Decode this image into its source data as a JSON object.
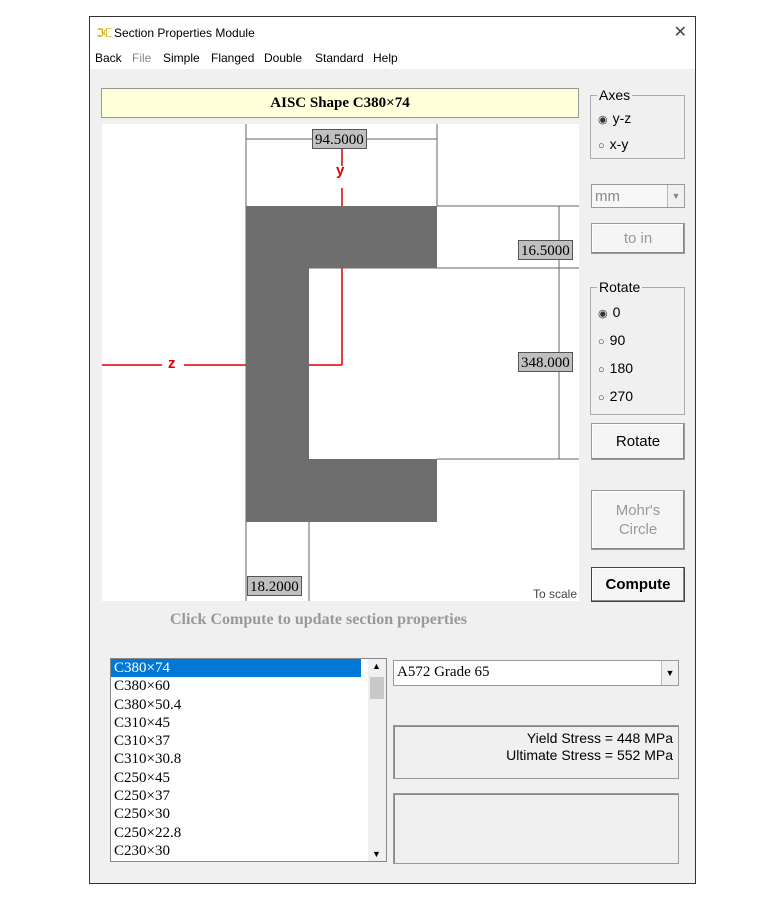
{
  "window": {
    "title": "Section Properties Module",
    "icon": "app-logo-icon"
  },
  "menu": [
    {
      "label": "Back",
      "enabled": true
    },
    {
      "label": "File",
      "enabled": false
    },
    {
      "label": "Simple",
      "enabled": true
    },
    {
      "label": "Flanged",
      "enabled": true
    },
    {
      "label": "Double",
      "enabled": true
    },
    {
      "label": "Standard",
      "enabled": true
    },
    {
      "label": "Help",
      "enabled": true
    }
  ],
  "shape_header": "AISC Shape  C380×74",
  "drawing": {
    "flange_width": "94.5000",
    "flange_thickness": "16.5000",
    "depth": "348.000",
    "web_thickness": "18.2000",
    "axis_y": "y",
    "axis_z": "z",
    "scale_note": "To scale"
  },
  "axes": {
    "label": "Axes",
    "options": [
      "y-z",
      "x-y"
    ],
    "selected": "y-z"
  },
  "units": {
    "value": "mm",
    "convert_label": "to in"
  },
  "rotate": {
    "label": "Rotate",
    "options": [
      "0",
      "90",
      "180",
      "270"
    ],
    "selected": "0",
    "button_label": "Rotate"
  },
  "mohr": {
    "line1": "Mohr's",
    "line2": "Circle"
  },
  "compute_label": "Compute",
  "status": "Click Compute to update section properties",
  "shapes": [
    "C380×74",
    "C380×60",
    "C380×50.4",
    "C310×45",
    "C310×37",
    "C310×30.8",
    "C250×45",
    "C250×37",
    "C250×30",
    "C250×22.8",
    "C230×30"
  ],
  "selected_shape": "C380×74",
  "material": {
    "value": "A572 Grade 65",
    "yield": "Yield Stress = 448 MPa",
    "ultimate": "Ultimate Stress = 552 MPa"
  },
  "colors": {
    "section_fill": "#6e6e6e",
    "axis": "#e00000",
    "header_bg": "#ffffd9",
    "selection": "#0078d7"
  }
}
